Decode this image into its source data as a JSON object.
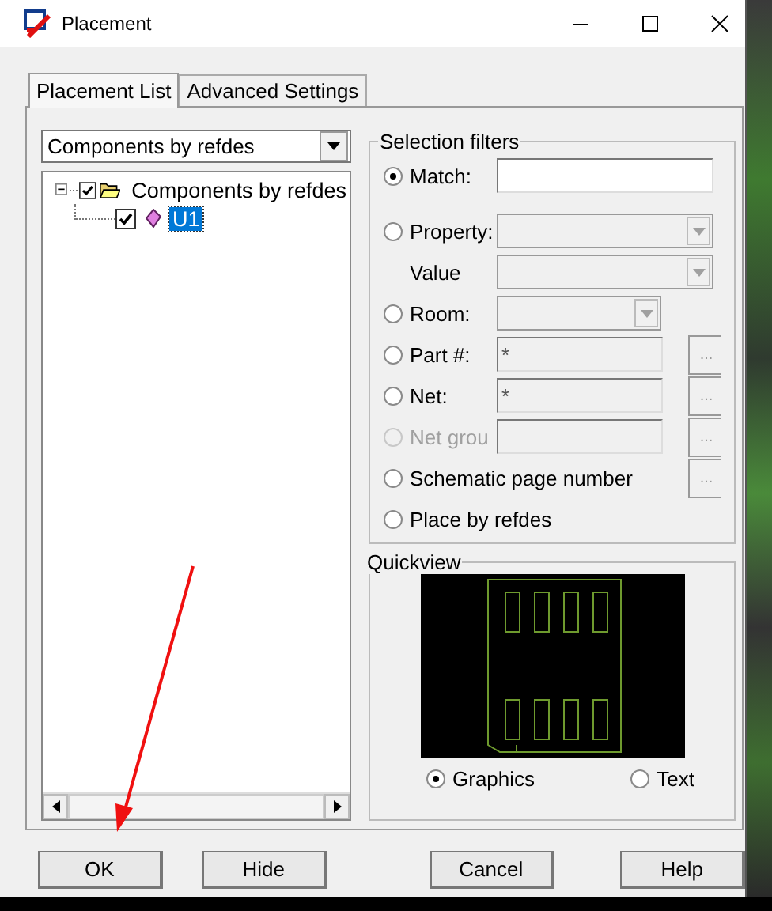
{
  "window": {
    "title": "Placement"
  },
  "tabs": [
    {
      "label": "Placement List",
      "selected": true
    },
    {
      "label": "Advanced Settings",
      "selected": false
    }
  ],
  "list_mode": {
    "value": "Components by refdes"
  },
  "tree": [
    {
      "label": "Components by refdes",
      "checked": true,
      "expanded": true,
      "selected": false,
      "children": [
        {
          "label": "U1",
          "checked": true,
          "selected": true
        }
      ]
    }
  ],
  "selection_filters": {
    "title": "Selection filters",
    "rows": [
      {
        "kind": "field",
        "label": "Match:",
        "selected": true,
        "disabled": false
      },
      {
        "kind": "combo",
        "label": "Property:",
        "selected": false,
        "disabled": false
      },
      {
        "kind": "sub_combo",
        "label": "Value"
      },
      {
        "kind": "combo_short",
        "label": "Room:",
        "selected": false,
        "disabled": false
      },
      {
        "kind": "field_browse",
        "label": "Part #:",
        "value": "*",
        "selected": false,
        "disabled": false
      },
      {
        "kind": "field_browse",
        "label": "Net:",
        "value": "*",
        "selected": false,
        "disabled": false
      },
      {
        "kind": "field_browse",
        "label": "Net grou",
        "selected": false,
        "disabled": true
      },
      {
        "kind": "browse",
        "label": "Schematic page number",
        "selected": false,
        "disabled": false
      },
      {
        "kind": "plain",
        "label": "Place by refdes",
        "selected": false,
        "disabled": false
      }
    ]
  },
  "quickview": {
    "title": "Quickview",
    "options": [
      {
        "label": "Graphics",
        "selected": true
      },
      {
        "label": "Text",
        "selected": false
      }
    ]
  },
  "buttons": [
    {
      "label": "OK"
    },
    {
      "label": "Hide"
    },
    {
      "label": "Cancel"
    },
    {
      "label": "Help"
    }
  ],
  "browse_label": "..."
}
